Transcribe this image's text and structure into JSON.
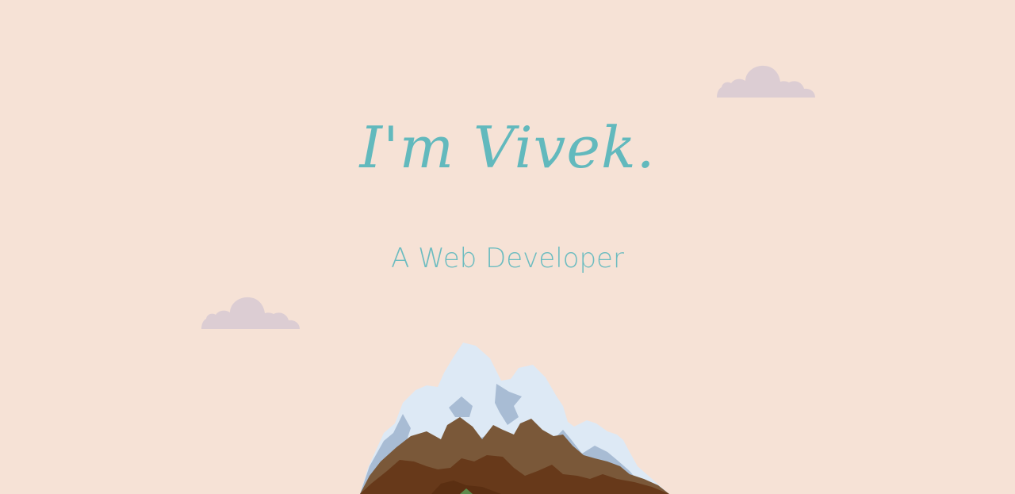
{
  "hero": {
    "title": "I'm Vivek.",
    "subtitle": "A Web Developer"
  },
  "colors": {
    "background": "#f6e2d6",
    "accent": "#62b9bd",
    "cloud": "#dccdd3",
    "snow": "#dde9f5",
    "snow_shadow": "#a8bcd4",
    "rock_light": "#7a5839",
    "rock_dark": "#67391a",
    "grass": "#5c8a4a"
  },
  "icons": [
    "cloud-icon",
    "cloud-icon",
    "mountain-illustration"
  ]
}
